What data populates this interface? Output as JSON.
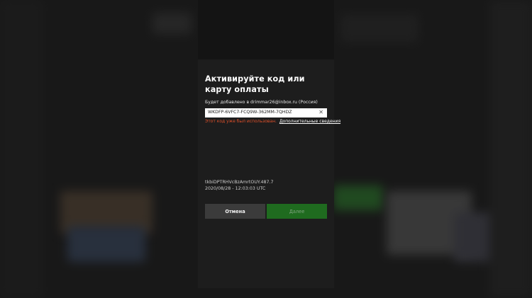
{
  "dialog": {
    "title": "Активируйте код или карту оплаты",
    "subtitle": "Будет добавлено в drimmar26@inbox.ru (Россия)",
    "code_value": "WKDFP-6VFC7-FCQ9W-362MM-7QHDZ",
    "clear_icon": "close-icon",
    "error_text": "Этот код уже был использован.",
    "details_link": "Дополнительные сведения",
    "meta_id": "tkbiDPTRHVcBzAmrtOUY.487.7",
    "meta_time": "2020/08/28 - 12:03:03 UTC",
    "cancel_label": "Отмена",
    "next_label": "Далее"
  },
  "colors": {
    "error": "#e0502a",
    "next_button": "#1f6b1f",
    "cancel_button": "#3b3b3b"
  }
}
